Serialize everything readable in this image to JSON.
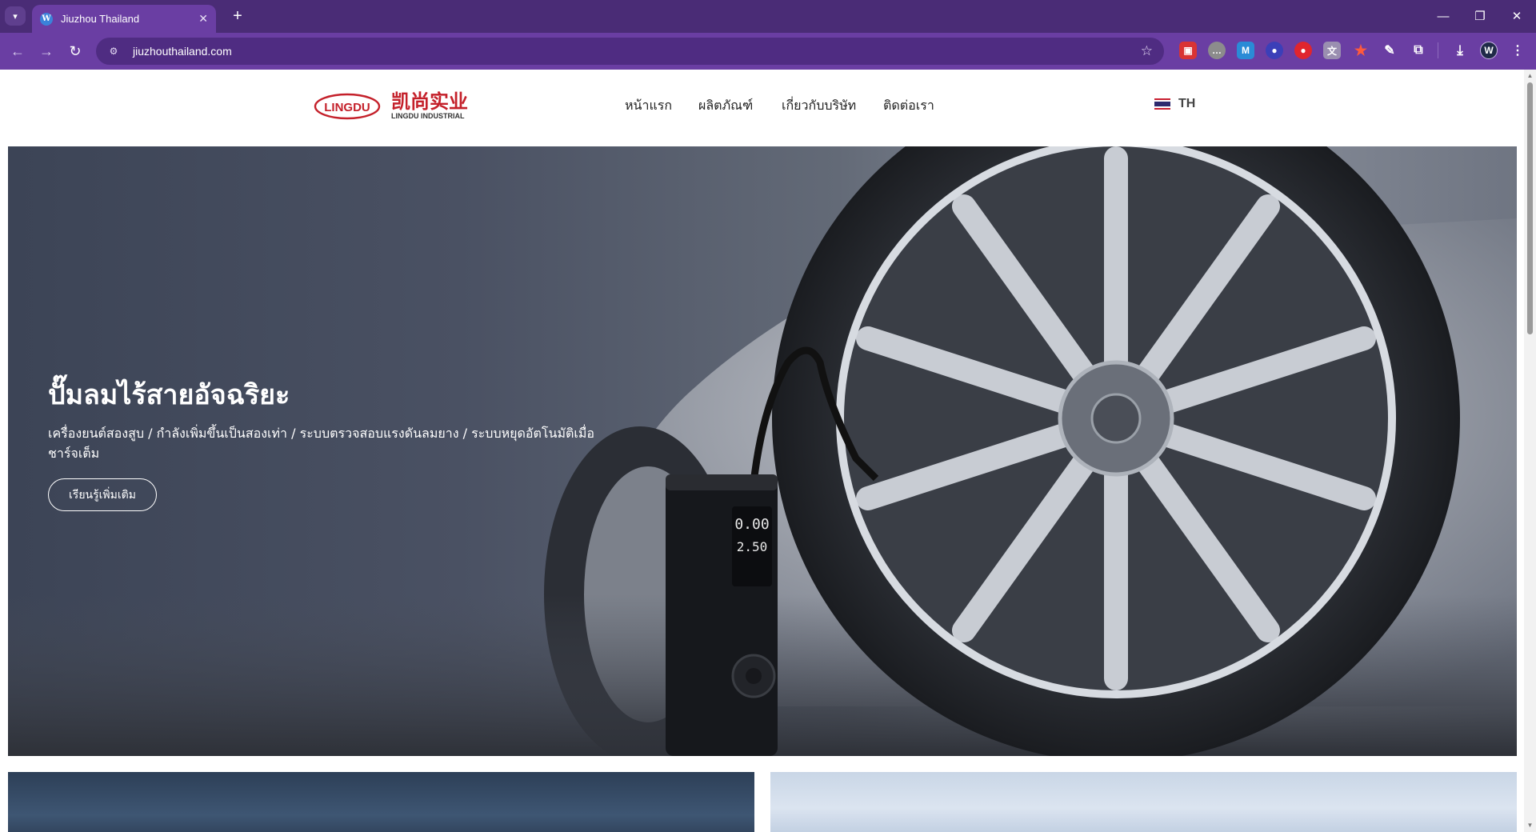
{
  "browser": {
    "tab_title": "Jiuzhou Thailand",
    "url": "jiuzhouthailand.com",
    "new_tab_label": "+",
    "tab_close_label": "✕",
    "win_minimize": "—",
    "win_restore": "❐",
    "win_close": "✕",
    "back_label": "←",
    "forward_label": "→",
    "reload_label": "↻",
    "bookmark_label": "☆",
    "extensions": [
      "ext-red",
      "ext-chat",
      "ext-mail",
      "ext-globe",
      "ext-record",
      "ext-translate",
      "ext-star",
      "ext-pen",
      "ext-puzzle"
    ],
    "download_label": "⤓",
    "profile_initial": "W",
    "menu_label": "⋮",
    "colors": {
      "frame": "#4a2c76",
      "toolbar": "#6a3ea3",
      "omnibox": "#4f2c82"
    }
  },
  "header": {
    "logo_left": "LINGDU",
    "logo_cn": "凯尚实业",
    "logo_en": "LINGDU INDUSTRIAL",
    "nav": [
      {
        "label": "หน้าแรก"
      },
      {
        "label": "ผลิตภัณฑ์"
      },
      {
        "label": "เกี่ยวกับบริษัท"
      },
      {
        "label": "ติดต่อเรา"
      }
    ],
    "language": "TH",
    "brand_color": "#c4202a"
  },
  "hero": {
    "title": "ปั๊มลมไร้สายอัจฉริยะ",
    "subtitle": "เครื่องยนต์สองสูบ / กำลังเพิ่มขึ้นเป็นสองเท่า / ระบบตรวจสอบแรงดันลมยาง / ระบบหยุดอัตโนมัติเมื่อชาร์จเต็ม",
    "cta": "เรียนรู้เพิ่มเติม",
    "device_reading_top": "0.00",
    "device_reading_bottom": "2.50"
  }
}
